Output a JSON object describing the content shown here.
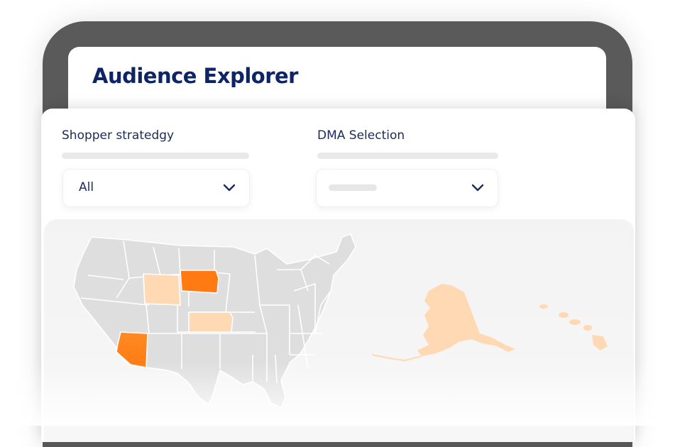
{
  "app": {
    "title": "Audience Explorer"
  },
  "filters": {
    "shopper_strategy": {
      "label": "Shopper stratedgy",
      "value": "All"
    },
    "dma": {
      "label": "DMA Selection",
      "value": ""
    }
  },
  "map": {
    "highlight_colors": {
      "strong": "#ff7a12",
      "light": "#ffd9b3",
      "base": "#dedede"
    },
    "states": {
      "arizona": "strong",
      "south-dakota": "strong",
      "wyoming": "light",
      "kansas": "light",
      "alaska": "light",
      "hawaii": "light"
    }
  }
}
